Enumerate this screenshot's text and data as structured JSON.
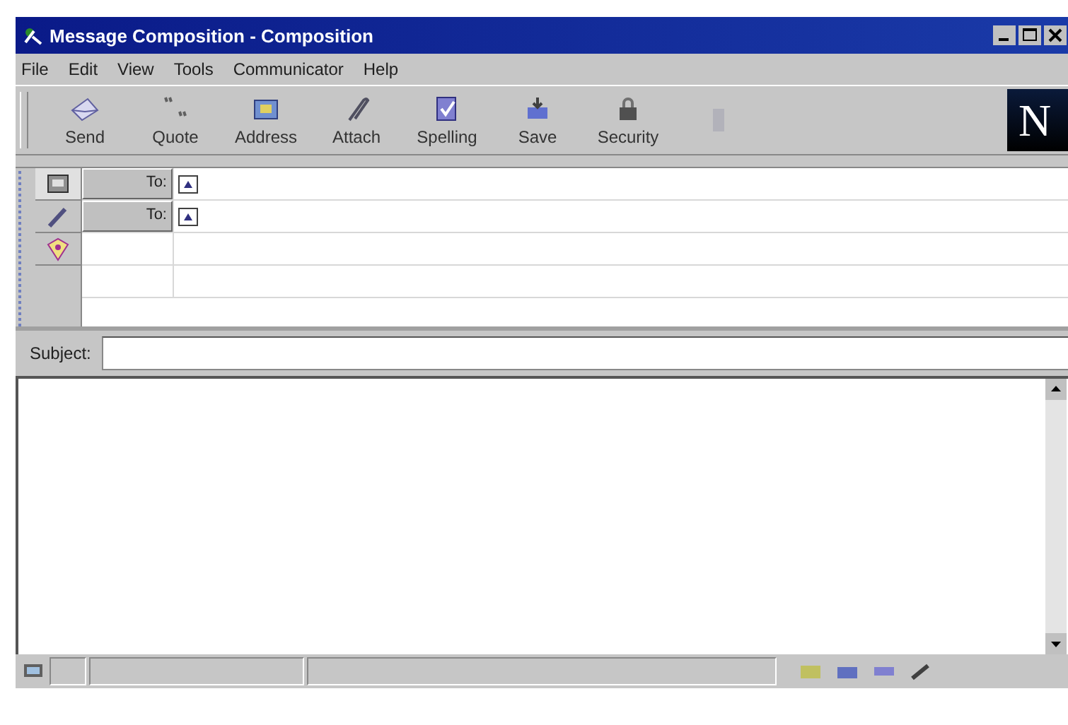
{
  "window": {
    "title": "Message Composition - Composition"
  },
  "menu": [
    {
      "label": "File"
    },
    {
      "label": "Edit"
    },
    {
      "label": "View"
    },
    {
      "label": "Tools"
    },
    {
      "label": "Communicator"
    },
    {
      "label": "Help"
    }
  ],
  "toolbar": [
    {
      "kind": "send",
      "label": "Send",
      "disabled": false
    },
    {
      "kind": "quote",
      "label": "Quote",
      "disabled": false
    },
    {
      "kind": "address",
      "label": "Address",
      "disabled": false
    },
    {
      "kind": "attach",
      "label": "Attach",
      "disabled": false
    },
    {
      "kind": "spelling",
      "label": "Spelling",
      "disabled": false
    },
    {
      "kind": "save",
      "label": "Save",
      "disabled": false
    },
    {
      "kind": "security",
      "label": "Security",
      "disabled": false
    },
    {
      "kind": "stop",
      "disabled": true
    }
  ],
  "logo": {
    "text": "N"
  },
  "address_tabs": [
    {
      "kind": "address",
      "selected": true
    },
    {
      "kind": "attach",
      "selected": false
    },
    {
      "kind": "options",
      "selected": false
    }
  ],
  "recipients": [
    {
      "field": "To:"
    },
    {
      "field": "To:"
    }
  ],
  "subject": {
    "label": "Subject:"
  }
}
